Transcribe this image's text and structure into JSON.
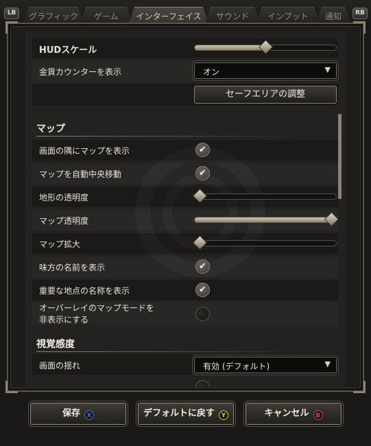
{
  "tabs": {
    "lb": "LB",
    "rb": "RB",
    "items": [
      {
        "label": "グラフィック"
      },
      {
        "label": "ゲーム"
      },
      {
        "label": "インターフェイス",
        "active": true
      },
      {
        "label": "サウンド"
      },
      {
        "label": "インプット"
      },
      {
        "label": "通知"
      }
    ]
  },
  "settings": {
    "hud_scale": {
      "label": "HUDスケール",
      "value_fraction": 0.5
    },
    "coin_counter": {
      "label": "金貨カウンターを表示",
      "value": "オン"
    },
    "safe_area_button": "セーフエリアの調整",
    "map_section": "マップ",
    "map_corner": {
      "label": "画面の隅にマップを表示",
      "checked": true
    },
    "map_autocenter": {
      "label": "マップを自動中央移動",
      "checked": true
    },
    "terrain_opacity": {
      "label": "地形の透明度",
      "value_fraction": 0.0
    },
    "map_opacity": {
      "label": "マップ透明度",
      "value_fraction": 1.0
    },
    "map_zoom": {
      "label": "マップ拡大",
      "value_fraction": 0.0
    },
    "ally_names": {
      "label": "味方の名前を表示",
      "checked": true
    },
    "poi_names": {
      "label": "重要な地点の名称を表示",
      "checked": true
    },
    "hide_overlay": {
      "label_line1": "オーバーレイのマップモードを",
      "label_line2": "非表示にする",
      "checked": false
    },
    "visual_section": "視覚感度",
    "screen_shake": {
      "label": "画面の揺れ",
      "value": "有効 (デフォルト)"
    }
  },
  "buttons": {
    "save": {
      "label": "保存",
      "pad": "X",
      "pad_color": "#3f6fd8"
    },
    "reset": {
      "label": "デフォルトに戻す",
      "pad": "Y",
      "pad_color": "#d9c23b"
    },
    "cancel": {
      "label": "キャンセル",
      "pad": "B",
      "pad_color": "#d8403a"
    }
  }
}
